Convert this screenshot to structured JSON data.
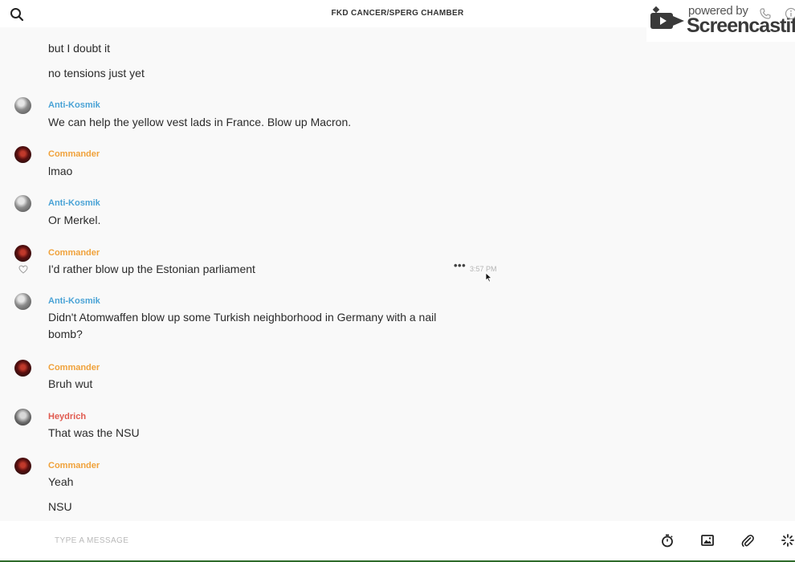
{
  "header": {
    "title": "FKD CANCER/SPERG CHAMBER"
  },
  "watermark": {
    "line1": "powered by",
    "line2": "Screencastify"
  },
  "messages": {
    "partial": "but I doubt it",
    "partial2": "no tensions just yet",
    "list": [
      {
        "sender": "Anti-Kosmik",
        "text": "We can help the yellow vest lads in France. Blow up Macron."
      },
      {
        "sender": "Commander",
        "text": "lmao"
      },
      {
        "sender": "Anti-Kosmik",
        "text": "Or Merkel."
      },
      {
        "sender": "Commander",
        "text": "I'd rather blow up the Estonian parliament",
        "time": "3:57 PM"
      },
      {
        "sender": "Anti-Kosmik",
        "text": "Didn't Atomwaffen blow up some Turkish neighborhood in Germany with a nail bomb?"
      },
      {
        "sender": "Commander",
        "text": "Bruh wut"
      },
      {
        "sender": "Heydrich",
        "text": "That was the NSU"
      },
      {
        "sender": "Commander",
        "text": "Yeah",
        "text2": "NSU"
      }
    ]
  },
  "composer": {
    "placeholder": "TYPE A MESSAGE",
    "value": ""
  },
  "colors": {
    "anti_kosmik": "#4aa3d6",
    "commander": "#f0a23b",
    "heydrich": "#e05a4f",
    "background": "#f9f9f9",
    "bar": "#ffffff"
  },
  "icons": [
    "search-icon",
    "heart-icon",
    "more-icon",
    "timer-icon",
    "image-icon",
    "paperclip-icon",
    "loading-icon",
    "phone-icon",
    "info-icon"
  ]
}
